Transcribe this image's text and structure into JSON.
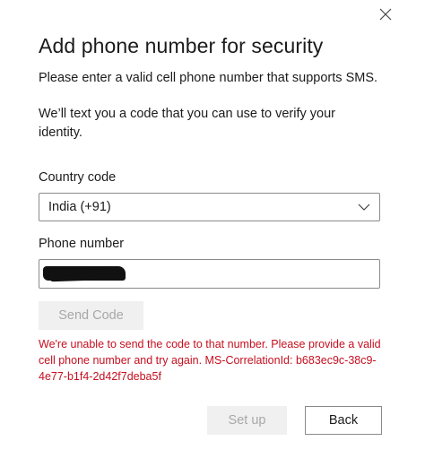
{
  "dialog": {
    "title": "Add phone number for security",
    "subtitle": "Please enter a valid cell phone number that supports SMS.",
    "info": "We’ll text you a code that you can use to verify your identity.",
    "close_icon": "close-icon"
  },
  "form": {
    "country_label": "Country code",
    "country_value": "India (+91)",
    "phone_label": "Phone number",
    "phone_value": "",
    "send_code_label": "Send Code",
    "error_message": "We're unable to send the code to that number. Please provide a valid cell phone number and try again. MS-CorrelationId: b683ec9c-38c9-4e77-b1f4-2d42f7deba5f"
  },
  "footer": {
    "setup_label": "Set up",
    "back_label": "Back"
  },
  "colors": {
    "error": "#c50f1f",
    "disabled_bg": "#f0f0f0",
    "disabled_text": "#a8a8a8",
    "border": "#8a8a8a"
  }
}
